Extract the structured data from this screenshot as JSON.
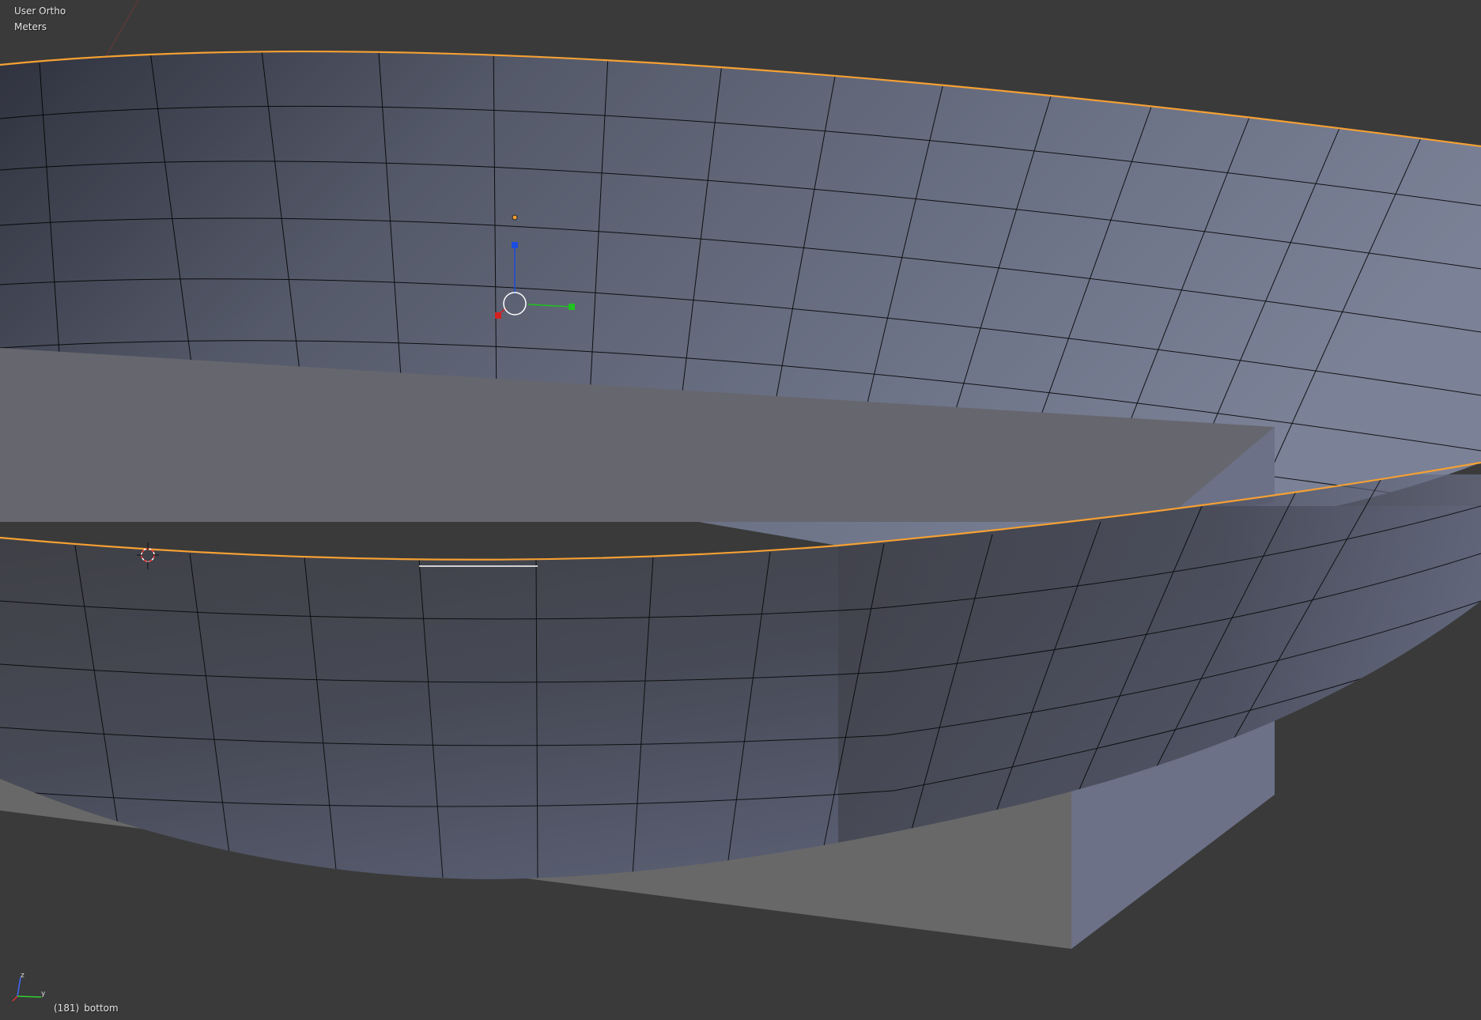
{
  "viewport": {
    "view_name": "User Ortho",
    "units": "Meters",
    "frame": "(181)",
    "object_name": "bottom"
  },
  "axis_widget": {
    "z_label": "z",
    "y_label": "y"
  },
  "colors": {
    "background": "#3a3a3a",
    "selection_outline": "#f5a033",
    "bowl_inner_light": "#7a8095",
    "bowl_inner_dark": "#2e313c",
    "bowl_outer": "#4b4e5c",
    "plane_top": "#66666e",
    "plane_front": "#686868",
    "plane_side": "#6c7187",
    "mesh_edges": "#000000",
    "gizmo_x": "#d62020",
    "gizmo_y": "#1fc21f",
    "gizmo_z": "#1a4de0",
    "cursor_red": "#ff3b3b",
    "cursor_white": "#ffffff"
  },
  "icons": {
    "3d_cursor": "crosshair-circle-icon",
    "transform_gizmo": "xyz-arrows-icon",
    "object_origin": "dot-icon"
  }
}
